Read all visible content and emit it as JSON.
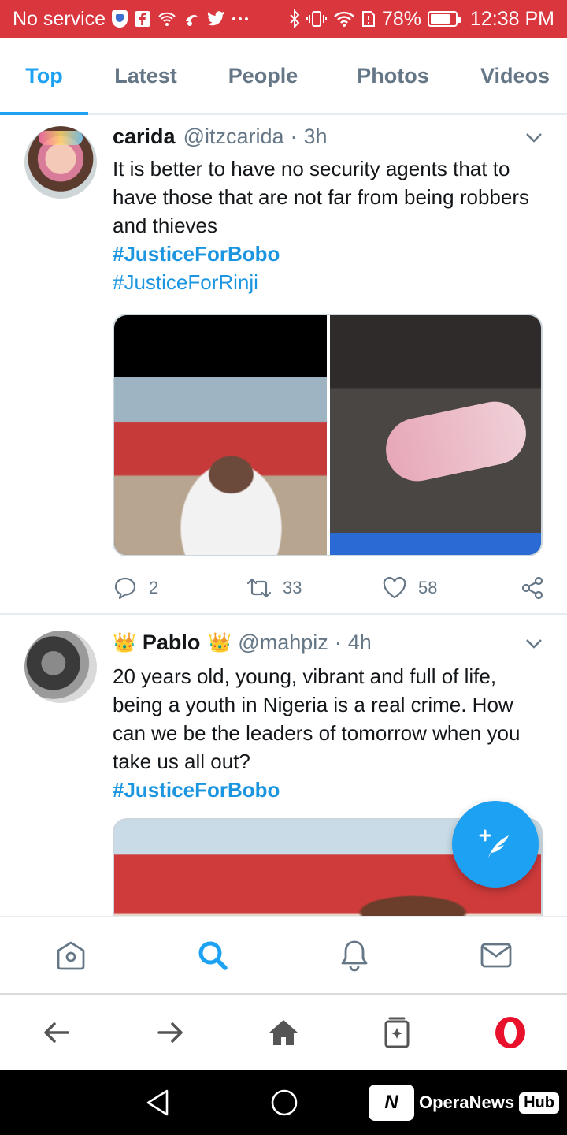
{
  "status_bar": {
    "carrier": "No service",
    "battery": "78%",
    "time": "12:38 PM"
  },
  "tabs": [
    {
      "label": "Top",
      "active": true
    },
    {
      "label": "Latest",
      "active": false
    },
    {
      "label": "People",
      "active": false
    },
    {
      "label": "Photos",
      "active": false
    },
    {
      "label": "Videos",
      "active": false
    }
  ],
  "tweets": [
    {
      "name": "carida",
      "handle": "@itzcarida",
      "time": "3h",
      "text": "It is better to have no security agents that to have those that are not far from being robbers and thieves",
      "hashtags": [
        "#JusticeForBobo",
        "#JusticeForRinji"
      ],
      "replies": "2",
      "retweets": "33",
      "likes": "58"
    },
    {
      "name": "Pablo",
      "name_decoration": "👑",
      "handle": "@mahpiz",
      "time": "4h",
      "text": "20 years old, young, vibrant and full of life, being a youth in Nigeria is a real crime. How can we be the leaders of tomorrow when you take us all out?",
      "hashtags": [
        "#JusticeForBobo"
      ]
    }
  ],
  "separator": "·",
  "watermark": {
    "logo": "N",
    "text": "OperaNews",
    "badge": "Hub"
  },
  "colors": {
    "status_bar": "#d9363e",
    "accent": "#1da1f2",
    "hashtag": "#1b95e0",
    "secondary_text": "#657786",
    "opera_red": "#e8102a"
  }
}
